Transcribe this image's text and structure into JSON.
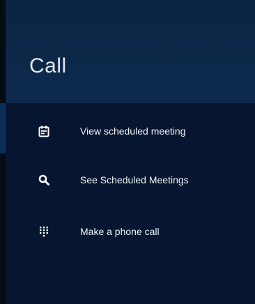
{
  "header": {
    "title": "Call"
  },
  "menu": {
    "items": [
      {
        "label": "View scheduled meeting",
        "icon": "calendar-note-icon"
      },
      {
        "label": "See Scheduled Meetings",
        "icon": "search-icon"
      },
      {
        "label": "Make a phone call",
        "icon": "dialpad-icon"
      }
    ]
  },
  "colors": {
    "background": "#06162f",
    "header": "#0b2443",
    "text": "#eef3f9",
    "title": "#dfe7f2"
  }
}
